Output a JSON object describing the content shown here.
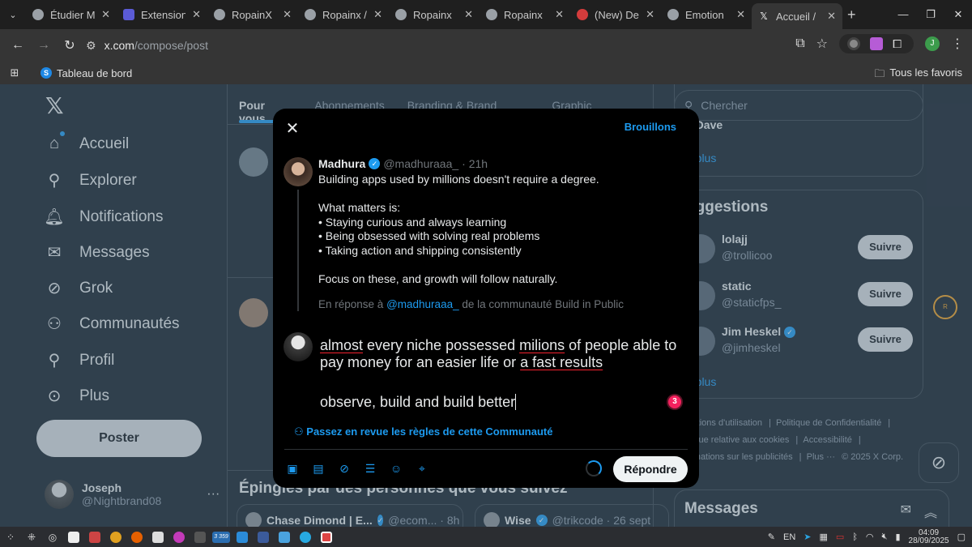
{
  "browser": {
    "tabs": [
      {
        "title": "Étudier M",
        "icon": "globe-icon"
      },
      {
        "title": "Extension",
        "icon": "puzzle-icon"
      },
      {
        "title": "RopainX",
        "icon": "globe-icon"
      },
      {
        "title": "Ropainx /",
        "icon": "globe-icon"
      },
      {
        "title": "Ropainx",
        "icon": "globe-icon"
      },
      {
        "title": "Ropainx",
        "icon": "globe-icon"
      },
      {
        "title": "(New) De",
        "icon": "red-logo-icon"
      },
      {
        "title": "Emotion",
        "icon": "globe-icon"
      },
      {
        "title": "Accueil /",
        "icon": "x-logo-icon",
        "active": true
      }
    ],
    "url_host": "x.com",
    "url_path": "/compose/post",
    "bookmark": "Tableau de bord",
    "bookmark_icon_letter": "S",
    "all_bookmarks": "Tous les favoris",
    "profile_letter": "J"
  },
  "sidebar": {
    "items": [
      {
        "label": "Accueil",
        "icon": "home-icon"
      },
      {
        "label": "Explorer",
        "icon": "search-icon"
      },
      {
        "label": "Notifications",
        "icon": "bell-icon"
      },
      {
        "label": "Messages",
        "icon": "mail-icon"
      },
      {
        "label": "Grok",
        "icon": "grok-icon"
      },
      {
        "label": "Communautés",
        "icon": "communities-icon"
      },
      {
        "label": "Profil",
        "icon": "person-icon"
      },
      {
        "label": "Plus",
        "icon": "more-icon"
      }
    ],
    "post_button": "Poster",
    "user_name": "Joseph",
    "user_handle": "@Nightbrand08"
  },
  "feed": {
    "tabs": [
      "Pour vous",
      "Abonnements",
      "Branding & Brand Design",
      "Graphic Designers"
    ],
    "pinned_title": "Épingles par des personnes que vous suivez",
    "pinned_cards": [
      {
        "name": "Chase Dimond | E...",
        "meta": "@ecom... · 8h"
      },
      {
        "name": "Wise",
        "meta": "@trikcode · 26 sept"
      }
    ]
  },
  "right": {
    "search_placeholder": "Chercher",
    "top_panel_name_fragment": "e Dave",
    "voir_plus": "ir plus",
    "suggestions_title": "uggestions",
    "suggestions": [
      {
        "name": "lolajj",
        "handle": "@trollicoo",
        "verified": false,
        "button": "Suivre"
      },
      {
        "name": "static",
        "handle": "@staticfps_",
        "verified": false,
        "button": "Suivre"
      },
      {
        "name": "Jim Heskel",
        "handle": "@jimheskel",
        "verified": true,
        "button": "Suivre"
      }
    ],
    "footer": [
      "nditions d'utilisation",
      "Politique de Confidentialité",
      "litique relative aux cookies",
      "Accessibilité",
      "ormations sur les publicités",
      "Plus ···",
      "© 2025 X Corp."
    ],
    "messages_title": "Messages",
    "ring_letter": "R"
  },
  "modal": {
    "drafts": "Brouillons",
    "original": {
      "name": "Madhura",
      "handle": "@madhuraaa_",
      "time": "· 21h",
      "lines": [
        "Building apps used by millions doesn't require a degree.",
        "",
        "What matters is:",
        "• Staying curious and always learning",
        "• Being obsessed with solving real problems",
        "• Taking action and shipping consistently",
        "",
        "Focus on these, and growth will follow naturally."
      ]
    },
    "reply_prefix": "En réponse à",
    "reply_mention": "@madhuraaa_",
    "reply_suffix": "de la communauté Build in Public",
    "compose": {
      "w1": "almost",
      "t1": " every niche possessed ",
      "w2": "milions",
      "t2": " of people able to pay money for an easier life or ",
      "w3": "a fast results",
      "line2": "observe, build and build better"
    },
    "grammar_count": "3",
    "rules": "Passez en revue les règles de cette Communauté",
    "tools": [
      "image-icon",
      "gif-icon",
      "grok-icon",
      "poll-icon",
      "emoji-icon",
      "location-icon"
    ],
    "reply_button": "Répondre"
  },
  "taskbar": {
    "lang": "EN",
    "time": "04:09",
    "date": "28/09/2025",
    "badge": "3 359"
  }
}
